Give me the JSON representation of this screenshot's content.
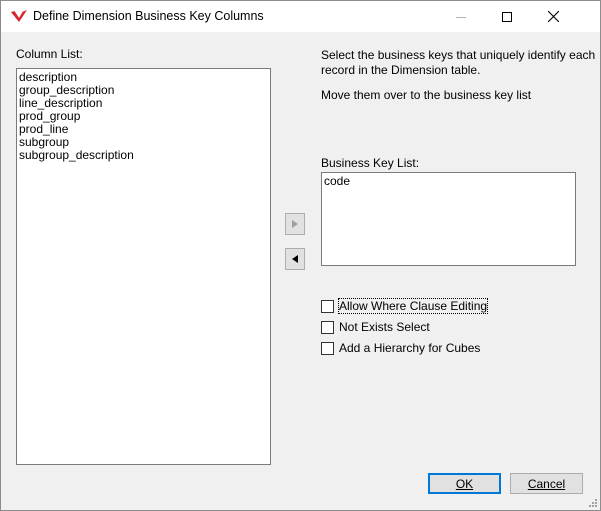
{
  "window": {
    "title": "Define Dimension Business Key Columns",
    "icons": {
      "app": "app-logo-icon",
      "minimize": "minimize-icon",
      "maximize": "maximize-icon",
      "close": "close-icon"
    }
  },
  "column_list": {
    "label": "Column List:",
    "items": [
      "description",
      "group_description",
      "line_description",
      "prod_group",
      "prod_line",
      "subgroup",
      "subgroup_description"
    ]
  },
  "instructions": {
    "line1": "Select the business keys that uniquely identify each",
    "line2": "record in the Dimension table.",
    "line3": "Move them over to the business key list"
  },
  "business_key_list": {
    "label": "Business Key List:",
    "items": [
      "code"
    ]
  },
  "move_buttons": {
    "add_icon": "arrow-right-icon",
    "remove_icon": "arrow-left-icon"
  },
  "options": {
    "allow_where": {
      "label": "Allow Where Clause Editing",
      "checked": false
    },
    "not_exists": {
      "label": "Not Exists Select",
      "checked": false
    },
    "hierarchy": {
      "label": "Add a Hierarchy for Cubes",
      "checked": false
    }
  },
  "buttons": {
    "ok": "OK",
    "cancel": "Cancel"
  }
}
